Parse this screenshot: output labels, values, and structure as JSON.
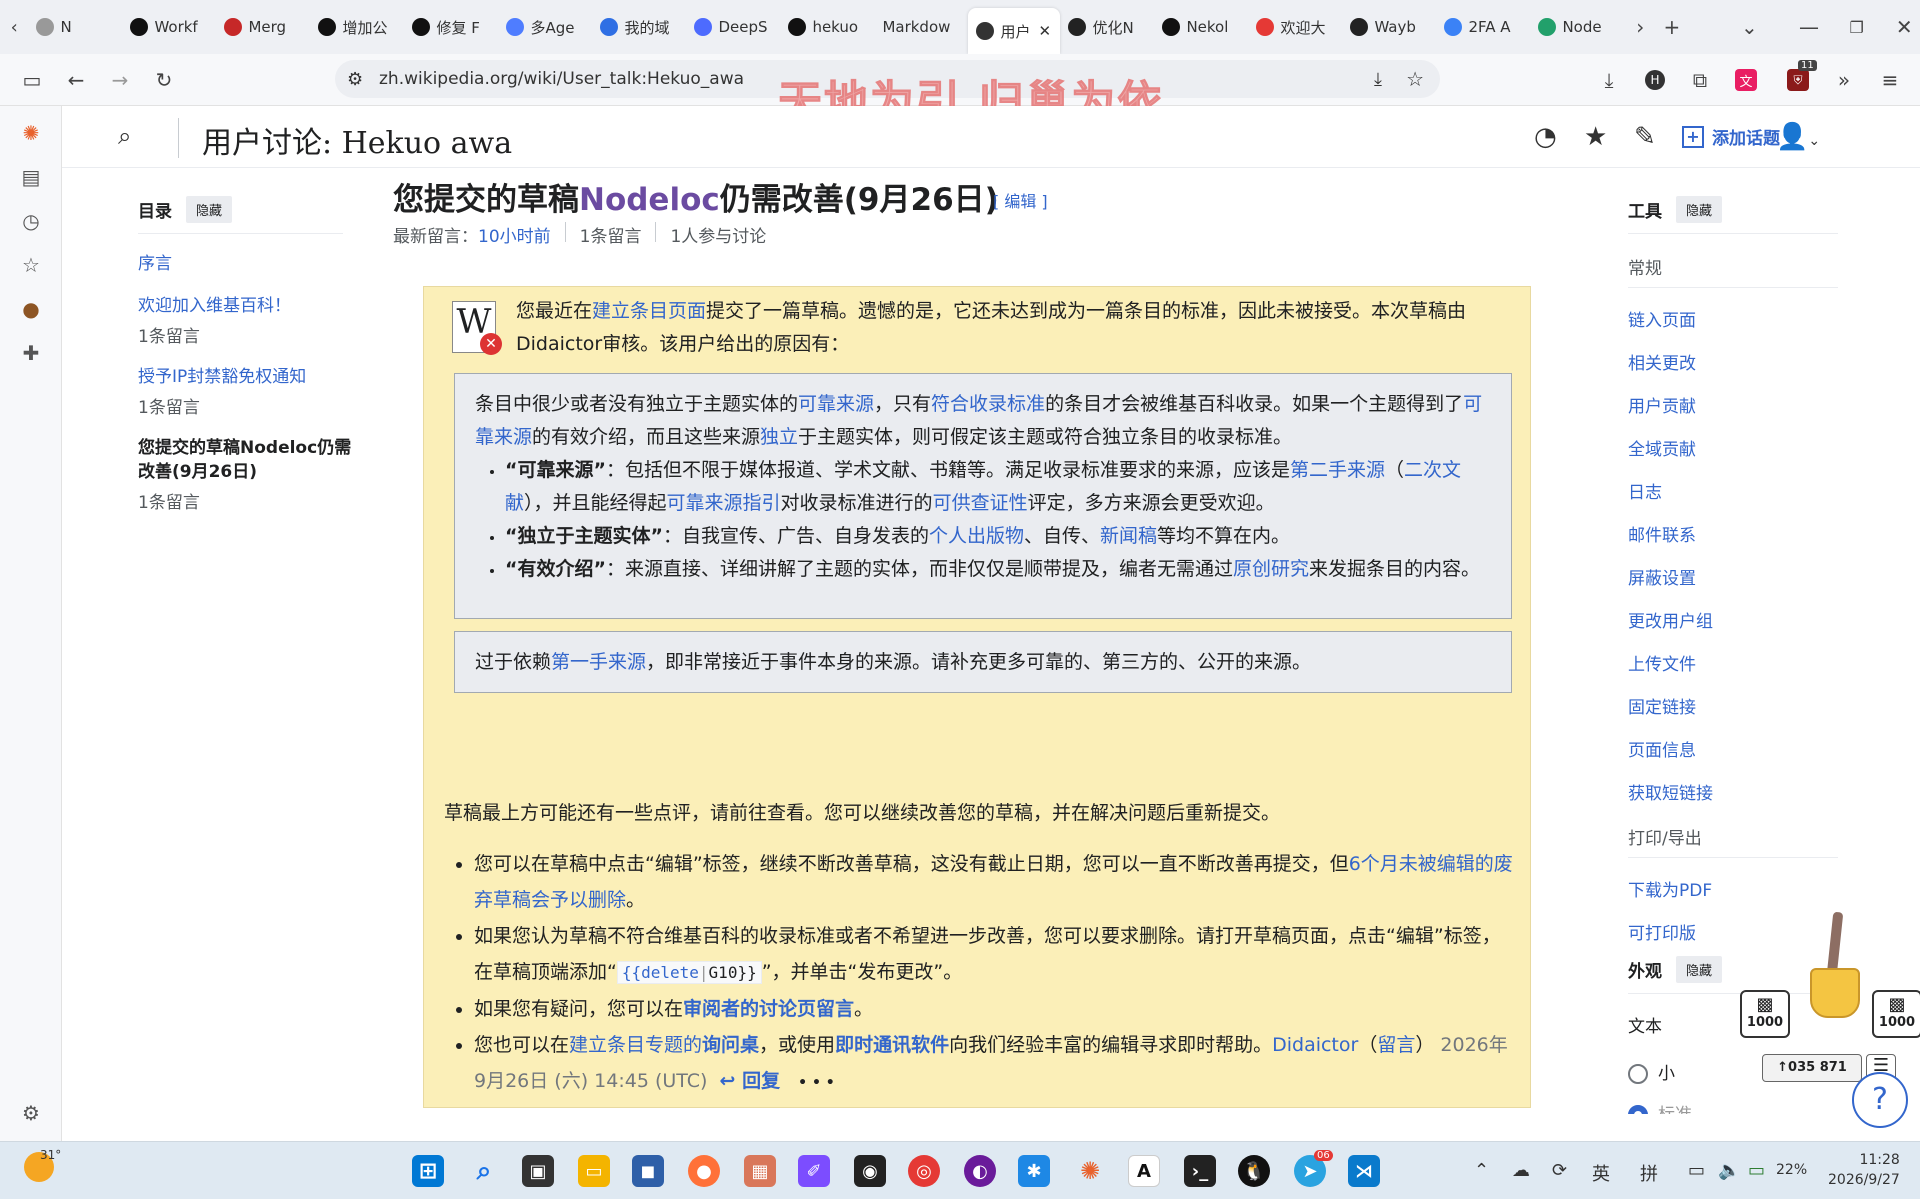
{
  "browser": {
    "tabs": [
      {
        "label": "N",
        "icon": "page-icon",
        "color": "#999999"
      },
      {
        "label": "Workf",
        "icon": "github-icon",
        "color": "#111111"
      },
      {
        "label": "Merg",
        "icon": "github-merge-icon",
        "color": "#c62828"
      },
      {
        "label": "增加公",
        "icon": "github-icon",
        "color": "#111111"
      },
      {
        "label": "修复 F",
        "icon": "github-icon",
        "color": "#111111"
      },
      {
        "label": "多Age",
        "icon": "gemini-icon",
        "color": "#4f7dff"
      },
      {
        "label": "我的域",
        "icon": "d-icon",
        "color": "#2f6fe4"
      },
      {
        "label": "DeepS",
        "icon": "deepseek-icon",
        "color": "#4d6bfe"
      },
      {
        "label": "hekuo",
        "icon": "github-icon",
        "color": "#111111"
      },
      {
        "label": "Markdow",
        "icon": "blank-icon",
        "color": "#eef0f4"
      },
      {
        "label": "用户",
        "icon": "wikipedia-icon",
        "color": "#333333"
      },
      {
        "label": "优化N",
        "icon": "openai-icon",
        "color": "#222222"
      },
      {
        "label": "Nekol",
        "icon": "github-icon",
        "color": "#111111"
      },
      {
        "label": "欢迎大",
        "icon": "star-badge-icon",
        "color": "#e53935"
      },
      {
        "label": "Wayb",
        "icon": "archive-icon",
        "color": "#222222"
      },
      {
        "label": "2FA A",
        "icon": "twofa-icon",
        "color": "#3b82f6"
      },
      {
        "label": "Node",
        "icon": "nodeloc-icon",
        "color": "#22a06b"
      }
    ],
    "url": "zh.wikipedia.org/wiki/User_talk:Hekuo_awa",
    "watermark": "天地为引 归巢为依",
    "ext_badge": "11"
  },
  "wiki": {
    "page_title": "用户讨论: Hekuo awa",
    "add_topic": "添加话题",
    "toc": {
      "heading": "目录",
      "hide": "隐藏",
      "items": [
        {
          "label": "序言",
          "count": ""
        },
        {
          "label": "欢迎加入维基百科！",
          "count": "1条留言"
        },
        {
          "label": "授予IP封禁豁免权通知",
          "count": "1条留言"
        },
        {
          "label": "您提交的草稿Nodeloc仍需改善(9月26日)",
          "count": "1条留言"
        }
      ]
    },
    "section": {
      "title_pre": "您提交的草稿",
      "title_link": "Nodeloc",
      "title_post": "仍需改善(9月26日)",
      "edit": "[ 编辑 ]",
      "meta_label": "最新留言：",
      "meta_time": "10小时前",
      "meta_comments": "1条留言",
      "meta_people": "1人参与讨论"
    },
    "notice": {
      "intro_1": "您最近在",
      "intro_link": "建立条目页面",
      "intro_2": "提交了一篇草稿。遗憾的是，它还未达到成为一篇条目的标准，因此未被接受。本次草稿由Didaictor审核。该用户给出的原因有：",
      "box1": {
        "t1": "条目中很少或者没有独立于主题实体的",
        "l1": "可靠来源",
        "t2": "，只有",
        "l2": "符合收录标准",
        "t3": "的条目才会被维基百科收录。如果一个主题得到了",
        "l3": "可靠来源",
        "t4": "的有效介绍，而且这些来源",
        "l4": "独立",
        "t5": "于主题实体，则可假定该主题或符合独立条目的收录标准。",
        "b1_term": "“可靠来源”",
        "b1_t1": "：包括但不限于媒体报道、学术文献、书籍等。满足收录标准要求的来源，应该是",
        "b1_l1": "第二手来源",
        "b1_t2": "（",
        "b1_l2": "二次文献",
        "b1_t3": "），并且能经得起",
        "b1_l3": "可靠来源指引",
        "b1_t4": "对收录标准进行的",
        "b1_l4": "可供查证性",
        "b1_t5": "评定，多方来源会更受欢迎。",
        "b2_term": "“独立于主题实体”",
        "b2_t1": "：自我宣传、广告、自身发表的",
        "b2_l1": "个人出版物",
        "b2_t2": "、自传、",
        "b2_l2": "新闻稿",
        "b2_t3": "等均不算在内。",
        "b3_term": "“有效介绍”",
        "b3_t1": "：来源直接、详细讲解了主题的实体，而非仅仅是顺带提及，编者无需通过",
        "b3_l1": "原创研究",
        "b3_t2": "来发掘条目的内容。"
      },
      "box2": {
        "t1": "过于依赖",
        "l1": "第一手来源",
        "t2": "，即非常接近于事件本身的来源。请补充更多可靠的、第三方的、公开的来源。"
      },
      "after_intro": "草稿最上方可能还有一些点评，请前往查看。您可以继续改善您的草稿，并在解决问题后重新提交。",
      "li1_t1": "您可以在草稿中点击“编辑”标签，继续不断改善草稿，这没有截止日期，您可以一直不断改善再提交，但",
      "li1_l1": "6个月未被编辑的废弃草稿会予以删除",
      "li1_t2": "。",
      "li2_t1": "如果您认为草稿不符合维基百科的收录标准或者不希望进一步改善，您可以要求删除。请打开草稿页面，点击“编辑”标签，在草稿顶端添加“",
      "li2_code_a": "{{delete",
      "li2_code_b": "G10}}",
      "li2_t2": "”，并单击“发布更改”。",
      "li3_t1": "如果您有疑问，您可以在",
      "li3_l1": "审阅者的讨论页留言",
      "li3_t2": "。",
      "li4_t1": "您也可以在",
      "li4_l1": "建立条目专题的",
      "li4_l1b": "询问桌",
      "li4_t2": "，或使用",
      "li4_l2": "即时通讯软件",
      "li4_t3": "向我们经验丰富的编辑寻求即时帮助。",
      "sig_user": "Didaictor",
      "sig_talk": "留言",
      "timestamp": "2026年9月26日 (六) 14:45 (UTC)",
      "reply": "回复",
      "more": "• • •"
    },
    "tools": {
      "heading": "工具",
      "hide": "隐藏",
      "general_label": "常规",
      "general": [
        "链入页面",
        "相关更改",
        "用户贡献",
        "全域贡献",
        "日志",
        "邮件联系",
        "屏蔽设置",
        "更改用户组",
        "上传文件",
        "固定链接",
        "页面信息",
        "获取短链接"
      ],
      "print_label": "打印/导出",
      "print": [
        "下载为PDF",
        "可打印版"
      ]
    },
    "appearance": {
      "heading": "外观",
      "hide": "隐藏",
      "text_label": "文本",
      "option_small": "小",
      "option_std": "标准"
    }
  },
  "widget": {
    "counter_left": "1000",
    "counter_right": "1000",
    "score": "↑035 871"
  },
  "taskbar": {
    "weather": "31°",
    "ime_lang": "英",
    "ime_mode": "拼",
    "battery": "22%",
    "time": "11:28",
    "date": "2026/9/27",
    "telegram_badge": "06"
  }
}
